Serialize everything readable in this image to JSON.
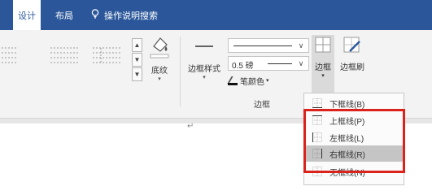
{
  "tabs": [
    {
      "label": "设计",
      "active": true
    },
    {
      "label": "布局",
      "active": false
    }
  ],
  "tell_me": {
    "label": "操作说明搜索"
  },
  "shading": {
    "label": "底纹"
  },
  "border_styles": {
    "label": "边框样式"
  },
  "line_weight": {
    "value": "0.5 磅"
  },
  "pen_color": {
    "label": "笔颜色"
  },
  "borders_button": {
    "label": "边框"
  },
  "border_painter": {
    "label": "边框刷"
  },
  "group_label": "边框",
  "paragraph_mark": "↵",
  "menu": {
    "items": [
      {
        "label": "下框线(B)",
        "icon": "bottom-border-icon"
      },
      {
        "label": "上框线(P)",
        "icon": "top-border-icon"
      },
      {
        "label": "左框线(L)",
        "icon": "left-border-icon"
      },
      {
        "label": "右框线(R)",
        "icon": "right-border-icon",
        "hovered": true
      },
      {
        "label": "无框线(N)",
        "icon": "no-border-icon"
      }
    ]
  },
  "colors": {
    "ribbon_blue": "#2b579a",
    "highlight_red": "#d9231b",
    "menu_hover": "#c5c5c5"
  }
}
